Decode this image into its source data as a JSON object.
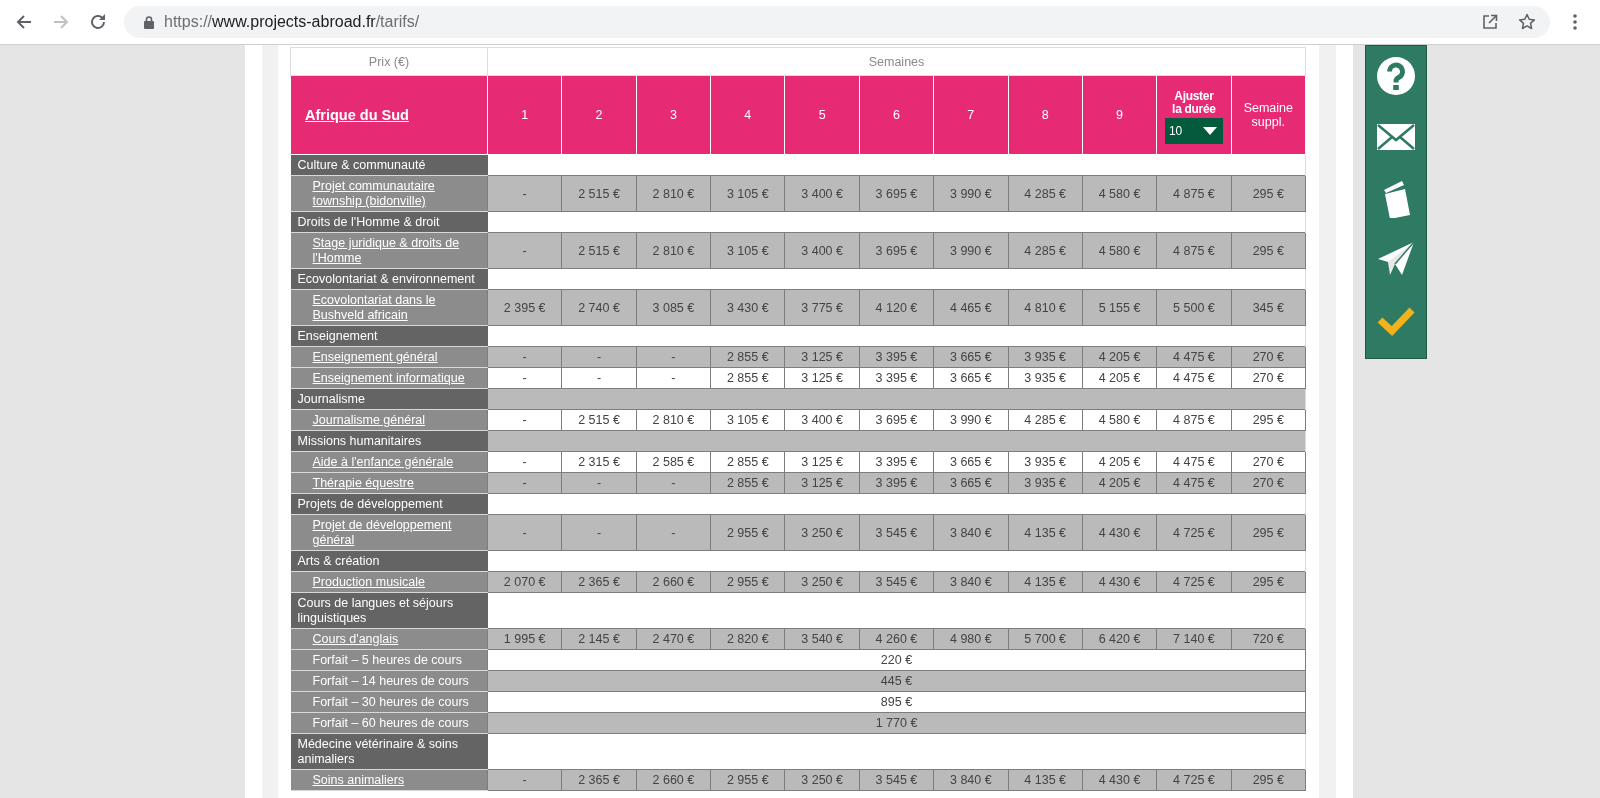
{
  "browser": {
    "url": {
      "scheme": "https://",
      "host": "www.projects-abroad.fr",
      "path": "/tarifs/"
    }
  },
  "table": {
    "price_header": "Prix (€)",
    "weeks_header": "Semaines",
    "country": "Afrique du Sud",
    "weeks": [
      "1",
      "2",
      "3",
      "4",
      "5",
      "6",
      "7",
      "8",
      "9"
    ],
    "duration": {
      "label": "Ajuster la durée",
      "value": "10"
    },
    "extra_week": "Semaine suppl.",
    "rows": [
      {
        "kind": "category",
        "label": "Culture & communauté",
        "shaded": false
      },
      {
        "kind": "program",
        "label": "Projet communautaire township (bidonville)",
        "shaded": true,
        "prices": [
          "-",
          "2 515 €",
          "2 810 €",
          "3 105 €",
          "3 400 €",
          "3 695 €",
          "3 990 €",
          "4 285 €",
          "4 580 €",
          "4 875 €",
          "295 €"
        ]
      },
      {
        "kind": "category",
        "label": "Droits de l'Homme & droit",
        "shaded": false
      },
      {
        "kind": "program",
        "label": "Stage juridique & droits de l'Homme",
        "shaded": true,
        "prices": [
          "-",
          "2 515 €",
          "2 810 €",
          "3 105 €",
          "3 400 €",
          "3 695 €",
          "3 990 €",
          "4 285 €",
          "4 580 €",
          "4 875 €",
          "295 €"
        ]
      },
      {
        "kind": "category",
        "label": "Ecovolontariat & environnement",
        "shaded": false
      },
      {
        "kind": "program",
        "label": "Ecovolontariat dans le Bushveld africain",
        "shaded": true,
        "prices": [
          "2 395 €",
          "2 740 €",
          "3 085 €",
          "3 430 €",
          "3 775 €",
          "4 120 €",
          "4 465 €",
          "4 810 €",
          "5 155 €",
          "5 500 €",
          "345 €"
        ]
      },
      {
        "kind": "category",
        "label": "Enseignement",
        "shaded": false
      },
      {
        "kind": "program",
        "label": "Enseignement général",
        "shaded": true,
        "prices": [
          "-",
          "-",
          "-",
          "2 855 €",
          "3 125 €",
          "3 395 €",
          "3 665 €",
          "3 935 €",
          "4 205 €",
          "4 475 €",
          "270 €"
        ]
      },
      {
        "kind": "program",
        "label": "Enseignement informatique",
        "shaded": false,
        "prices": [
          "-",
          "-",
          "-",
          "2 855 €",
          "3 125 €",
          "3 395 €",
          "3 665 €",
          "3 935 €",
          "4 205 €",
          "4 475 €",
          "270 €"
        ]
      },
      {
        "kind": "category",
        "label": "Journalisme",
        "shaded": true
      },
      {
        "kind": "program",
        "label": "Journalisme général",
        "shaded": false,
        "prices": [
          "-",
          "2 515 €",
          "2 810 €",
          "3 105 €",
          "3 400 €",
          "3 695 €",
          "3 990 €",
          "4 285 €",
          "4 580 €",
          "4 875 €",
          "295 €"
        ]
      },
      {
        "kind": "category",
        "label": "Missions humanitaires",
        "shaded": true
      },
      {
        "kind": "program",
        "label": "Aide à l'enfance générale",
        "shaded": false,
        "prices": [
          "-",
          "2 315 €",
          "2 585 €",
          "2 855 €",
          "3 125 €",
          "3 395 €",
          "3 665 €",
          "3 935 €",
          "4 205 €",
          "4 475 €",
          "270 €"
        ]
      },
      {
        "kind": "program",
        "label": "Thérapie équestre",
        "shaded": true,
        "prices": [
          "-",
          "-",
          "-",
          "2 855 €",
          "3 125 €",
          "3 395 €",
          "3 665 €",
          "3 935 €",
          "4 205 €",
          "4 475 €",
          "270 €"
        ]
      },
      {
        "kind": "category",
        "label": "Projets de développement",
        "shaded": false
      },
      {
        "kind": "program",
        "label": "Projet de développement général",
        "shaded": true,
        "prices": [
          "-",
          "-",
          "-",
          "2 955 €",
          "3 250 €",
          "3 545 €",
          "3 840 €",
          "4 135 €",
          "4 430 €",
          "4 725 €",
          "295 €"
        ]
      },
      {
        "kind": "category",
        "label": "Arts & création",
        "shaded": false
      },
      {
        "kind": "program",
        "label": "Production musicale",
        "shaded": true,
        "prices": [
          "2 070 €",
          "2 365 €",
          "2 660 €",
          "2 955 €",
          "3 250 €",
          "3 545 €",
          "3 840 €",
          "4 135 €",
          "4 430 €",
          "4 725 €",
          "295 €"
        ]
      },
      {
        "kind": "category",
        "label": "Cours de langues et séjours linguistiques",
        "shaded": false
      },
      {
        "kind": "program",
        "label": "Cours d'anglais",
        "shaded": true,
        "prices": [
          "1 995 €",
          "2 145 €",
          "2 470 €",
          "2 820 €",
          "3 540 €",
          "4 260 €",
          "4 980 €",
          "5 700 €",
          "6 420 €",
          "7 140 €",
          "720 €"
        ]
      },
      {
        "kind": "package",
        "label": "Forfait – 5 heures de cours",
        "shaded": false,
        "price": "220 €"
      },
      {
        "kind": "package",
        "label": "Forfait – 14 heures de cours",
        "shaded": true,
        "price": "445 €"
      },
      {
        "kind": "package",
        "label": "Forfait – 30 heures de cours",
        "shaded": false,
        "price": "895 €"
      },
      {
        "kind": "package",
        "label": "Forfait – 60 heures de cours",
        "shaded": true,
        "price": "1 770 €"
      },
      {
        "kind": "category",
        "label": "Médecine vétérinaire & soins animaliers",
        "shaded": false
      },
      {
        "kind": "program",
        "label": "Soins animaliers",
        "shaded": true,
        "prices": [
          "-",
          "2 365 €",
          "2 660 €",
          "2 955 €",
          "3 250 €",
          "3 545 €",
          "3 840 €",
          "4 135 €",
          "4 430 €",
          "4 725 €",
          "295 €"
        ]
      }
    ]
  }
}
